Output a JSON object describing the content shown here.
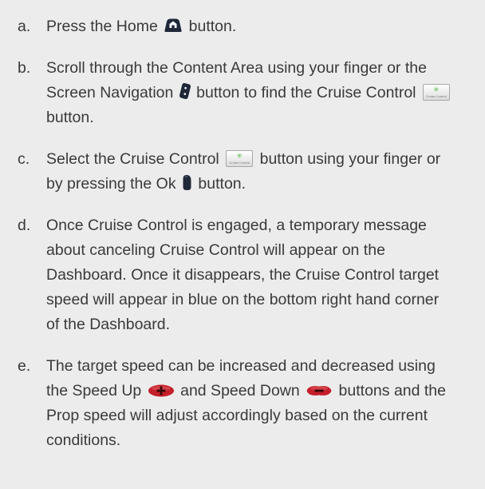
{
  "steps": [
    {
      "letter": "a.",
      "parts": [
        "Press the Home ",
        " button."
      ]
    },
    {
      "letter": "b.",
      "parts": [
        "Scroll through the Content Area using your finger or the Screen Navigation ",
        " button to find the Cruise Control ",
        " button."
      ]
    },
    {
      "letter": "c.",
      "parts": [
        "Select the Cruise Control ",
        " button using your finger or by pressing the Ok ",
        " button."
      ]
    },
    {
      "letter": "d.",
      "parts": [
        "Once Cruise Control is engaged, a temporary message about canceling Cruise Control will appear on the Dashboard.  Once it disappears, the Cruise Control target speed will appear in blue on the bottom right hand corner of the Dashboard."
      ]
    },
    {
      "letter": "e.",
      "parts": [
        "The target speed can be increased and decreased using the Speed Up ",
        " and Speed Down ",
        " buttons and the Prop speed will adjust accordingly based on the current conditions."
      ]
    }
  ],
  "icons": {
    "home": "home-button-icon",
    "screen_navigation": "screen-navigation-button-icon",
    "cruise_control": "cruise-control-button-icon",
    "ok": "ok-button-icon",
    "speed_up": "speed-up-button-icon",
    "speed_down": "speed-down-button-icon"
  },
  "cruise_control_icon": {
    "glyph": "✳",
    "caption": "Cruise Control"
  },
  "colors": {
    "background": "#ececec",
    "text": "#3a3a3a",
    "button_dark": "#1f2838",
    "speed_button_red": "#c41f2a",
    "cruise_icon_green": "#58b848"
  }
}
